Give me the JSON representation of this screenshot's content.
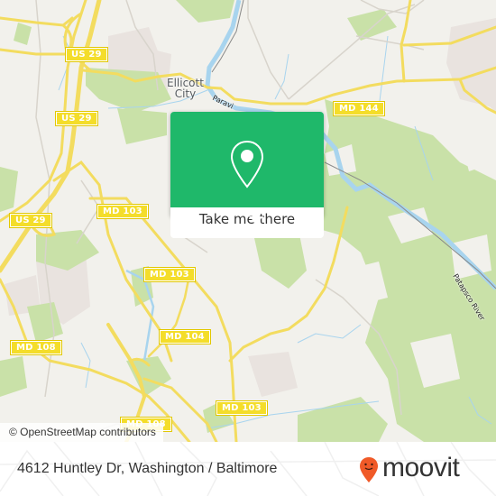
{
  "map": {
    "place_labels": {
      "ellicott_city_line1": "Ellicott",
      "ellicott_city_line2": "City"
    },
    "river_label": "Patapsco River",
    "road_label_partial": "Paravi",
    "shields": [
      {
        "id": "us29-north",
        "label": "US 29"
      },
      {
        "id": "us29-mid",
        "label": "US 29"
      },
      {
        "id": "us29-south",
        "label": "US 29"
      },
      {
        "id": "md144",
        "label": "MD 144"
      },
      {
        "id": "md103-west",
        "label": "MD 103"
      },
      {
        "id": "md103-center",
        "label": "MD 103"
      },
      {
        "id": "md104",
        "label": "MD 104"
      },
      {
        "id": "md108-west",
        "label": "MD 108"
      },
      {
        "id": "md103-south",
        "label": "MD 103"
      },
      {
        "id": "md108-south",
        "label": "MD 108"
      }
    ],
    "colors": {
      "background": "#f2f1ec",
      "park": "#c8e0a6",
      "water": "#a8d4ee",
      "major_road": "#f6e26b",
      "residential": "#e8e0dc"
    },
    "attribution": "© OpenStreetMap contributors"
  },
  "popup": {
    "icon": "location-pin-icon",
    "button_label": "Take me there",
    "accent_color": "#1fb86a"
  },
  "footer": {
    "address": "4612 Huntley Dr, Washington / Baltimore",
    "brand": "moovit",
    "brand_icon": "moovit-smiley-pin-icon",
    "brand_color": "#f05a28"
  }
}
